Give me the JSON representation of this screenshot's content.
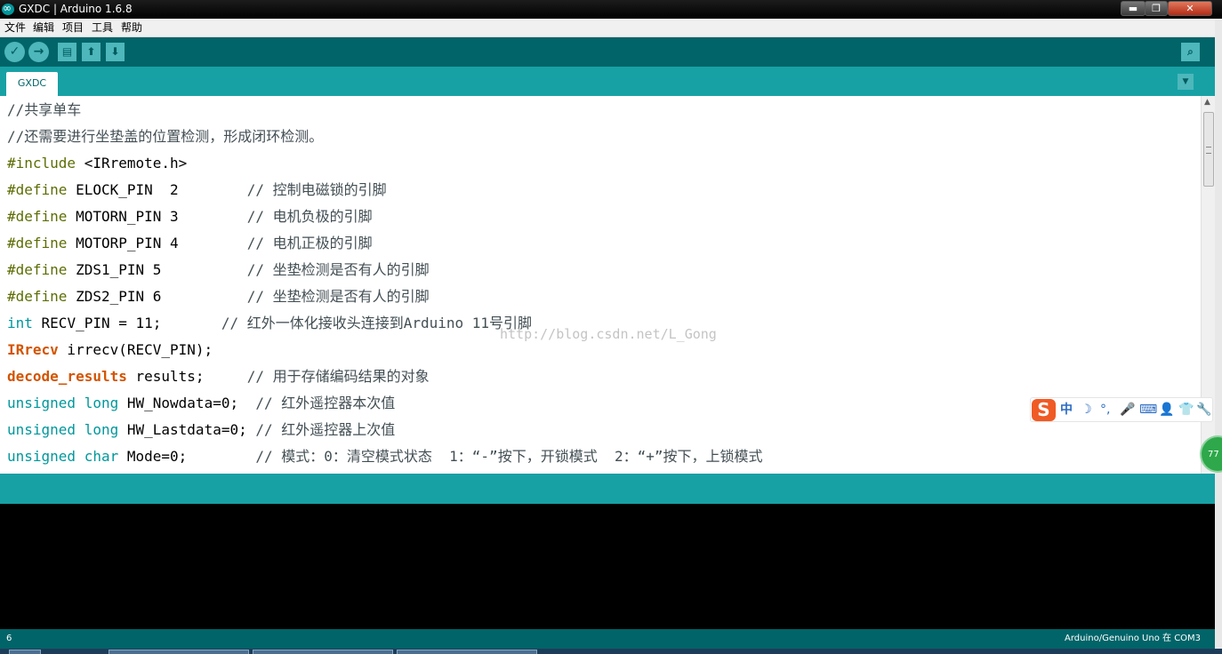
{
  "window": {
    "title": "GXDC | Arduino 1.6.8",
    "controls": {
      "minimize": "▬",
      "maximize": "❐",
      "close": "✕"
    }
  },
  "menu": [
    "文件",
    "编辑",
    "项目",
    "工具",
    "帮助"
  ],
  "toolbar": {
    "verify_icon": "✓",
    "upload_icon": "→",
    "new_icon": "▤",
    "open_icon": "⬆",
    "save_icon": "⬇",
    "serial_monitor_icon": "⌕"
  },
  "tabs": [
    {
      "label": "GXDC",
      "active": true
    }
  ],
  "tab_menu_icon": "▼",
  "code": {
    "line1": "//共享单车",
    "line2": "//还需要进行坐垫盖的位置检测，形成闭环检测。",
    "line3": {
      "directive": "#include",
      "rest": " <IRremote.h>"
    },
    "line4": {
      "directive": "#define",
      "rest": " ELOCK_PIN  2        ",
      "comment": "// 控制电磁锁的引脚"
    },
    "line5": {
      "directive": "#define",
      "rest": " MOTORN_PIN 3        ",
      "comment": "// 电机负极的引脚"
    },
    "line6": {
      "directive": "#define",
      "rest": " MOTORP_PIN 4        ",
      "comment": "// 电机正极的引脚"
    },
    "line7": {
      "directive": "#define",
      "rest": " ZDS1_PIN 5          ",
      "comment": "// 坐垫检测是否有人的引脚"
    },
    "line8": {
      "directive": "#define",
      "rest": " ZDS2_PIN 6          ",
      "comment": "// 坐垫检测是否有人的引脚"
    },
    "line9": {
      "type": "int",
      "rest": " RECV_PIN = 11;       ",
      "comment": "// 红外一体化接收头连接到Arduino 11号引脚"
    },
    "line10": {
      "class": "IRrecv",
      "rest": " irrecv(RECV_PIN);"
    },
    "line11": {
      "class": "decode_results",
      "rest": " results;     ",
      "comment": "// 用于存储编码结果的对象"
    },
    "line12": {
      "type": "unsigned long",
      "rest": " HW_Nowdata=0;  ",
      "comment": "// 红外遥控器本次值"
    },
    "line13": {
      "type": "unsigned long",
      "rest": " HW_Lastdata=0; ",
      "comment": "// 红外遥控器上次值"
    },
    "line14": {
      "type": "unsigned char",
      "rest": " Mode=0;        ",
      "comment": "// 模式：0：清空模式状态  1：“-”按下，开锁模式  2：“+”按下，上锁模式"
    }
  },
  "watermark": "http://blog.csdn.net/L_Gong",
  "ime": {
    "logo": "S",
    "icons": [
      "中",
      "☽",
      "°,",
      "🎤",
      "⌨",
      "👤",
      "👕",
      "🔧"
    ]
  },
  "float_badge": "77",
  "status": {
    "line_number": "6",
    "board_port": "Arduino/Genuino Uno 在 COM3"
  }
}
